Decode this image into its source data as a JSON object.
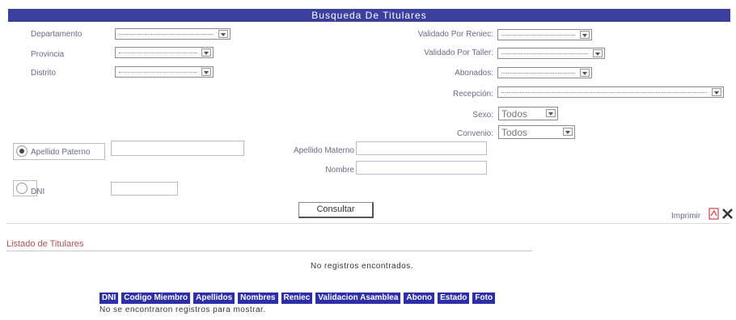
{
  "header": {
    "title": "Busqueda De Titulares"
  },
  "filters": {
    "departamento": {
      "label": "Departamento"
    },
    "provincia": {
      "label": "Provincia"
    },
    "distrito": {
      "label": "Distrito"
    },
    "validado_reniec": {
      "label": "Validado Por Reniec:"
    },
    "validado_taller": {
      "label": "Validado Por Taller:"
    },
    "abonados": {
      "label": "Abonados:"
    },
    "recepcion": {
      "label": "Recepción:"
    },
    "sexo": {
      "label": "Sexo:",
      "value": "Todos"
    },
    "convenio": {
      "label": "Convenio:",
      "value": "Todos"
    }
  },
  "search": {
    "apellido_paterno_label": "Apellido Paterno",
    "apellido_materno_label": "Apellido Materno",
    "nombre_label": "Nombre",
    "dni_label": "DNI",
    "selected_mode": "apellido"
  },
  "actions": {
    "consultar_label": "Consultar",
    "imprimir_label": "Imprimir"
  },
  "results": {
    "section_title": "Listado de Titulares",
    "no_records": "No registros encontrados.",
    "columns": [
      "DNI",
      "Codigo Miembro",
      "Apellidos",
      "Nombres",
      "Reniec",
      "Validacion Asamblea",
      "Abono",
      "Estado",
      "Foto"
    ],
    "empty_message": "No se encontraron registros para mostrar."
  },
  "colors": {
    "header_bg": "#3b3f9e",
    "table_header_bg": "#2d2ea8",
    "link": "#b05050"
  }
}
